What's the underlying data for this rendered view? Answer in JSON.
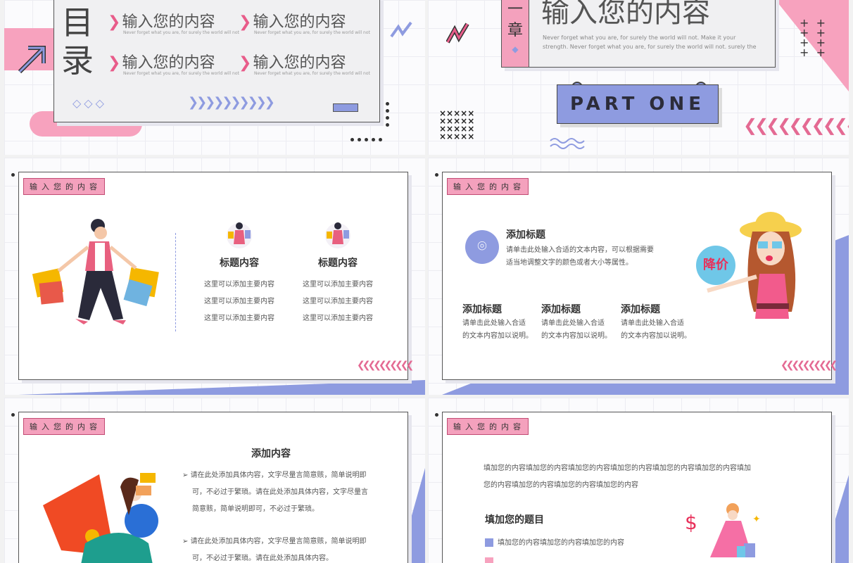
{
  "slide1": {
    "title_chars": [
      "目",
      "录"
    ],
    "menu": [
      {
        "label": "输入您的内容",
        "sub": "Never forget what you are, for surely the world will not"
      },
      {
        "label": "输入您的内容",
        "sub": "Never forget what you are, for surely the world will not"
      },
      {
        "label": "输入您的内容",
        "sub": "Never forget what you are, for surely the world will not"
      },
      {
        "label": "输入您的内容",
        "sub": "Never forget what you are, for surely the world will not"
      }
    ]
  },
  "slide2": {
    "chapter_chars": "一章",
    "title": "输入您的内容",
    "subtitle": "Never forget what you are, for surely the world will not. Make it your strength. Never forget what you are, for surely the world will not. surely the",
    "part": "PART ONE"
  },
  "slide3": {
    "tag": "输入您的内容",
    "columns": [
      {
        "title": "标题内容",
        "lines": [
          "这里可以添加主要内容",
          "这里可以添加主要内容",
          "这里可以添加主要内容"
        ]
      },
      {
        "title": "标题内容",
        "lines": [
          "这里可以添加主要内容",
          "这里可以添加主要内容",
          "这里可以添加主要内容"
        ]
      }
    ]
  },
  "slide4": {
    "tag": "输入您的内容",
    "main_title": "添加标题",
    "main_text_1": "请单击此处输入合适的文本内容，可以根据需要",
    "main_text_2": "适当地调整文字的颜色或者大小等属性。",
    "badge": "降价",
    "items": [
      {
        "title": "添加标题",
        "line1": "请单击此处输入合适",
        "line2": "的文本内容加以说明。"
      },
      {
        "title": "添加标题",
        "line1": "请单击此处输入合适",
        "line2": "的文本内容加以说明。"
      },
      {
        "title": "添加标题",
        "line1": "请单击此处输入合适",
        "line2": "的文本内容加以说明。"
      }
    ]
  },
  "slide5": {
    "tag": "输入您的内容",
    "title": "添加内容",
    "para1": [
      "请在此处添加具体内容，文字尽量言简意赅，简单说明即",
      "可，不必过于繁琐。请在此处添加具体内容，文字尽量言",
      "简意赅，简单说明即可，不必过于繁琐。"
    ],
    "para2": [
      "请在此处添加具体内容，文字尽量言简意赅，简单说明即",
      "可，不必过于繁琐。请在此处添加具体内容。"
    ]
  },
  "slide6": {
    "tag": "输入您的内容",
    "para_line1": "填加您的内容填加您的内容填加您的内容填加您的内容填加您的内容填加您的内容填加",
    "para_line2": "您的内容填加您的内容填加您的内容填加您的内容",
    "subtitle": "填加您的题目",
    "bullet1": "填加您的内容填加您的内容填加您的内容"
  },
  "colors": {
    "pink": "#f7a2be",
    "purple": "#8e9be0",
    "dark": "#333333"
  }
}
